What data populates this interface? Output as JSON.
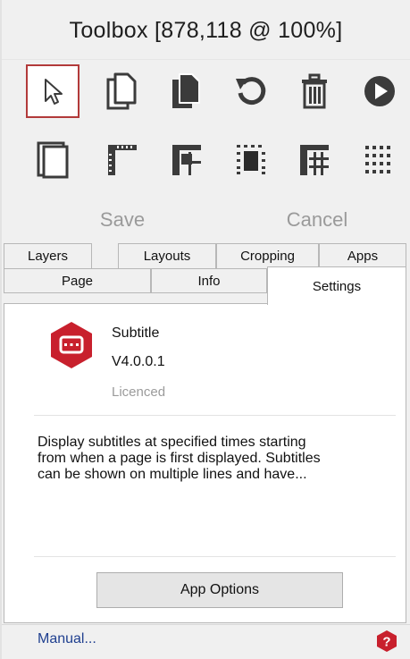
{
  "window": {
    "title": "Toolbox [878,118 @ 100%]"
  },
  "toolbar": {
    "row1": [
      {
        "icon": "pointer-icon",
        "selected": true
      },
      {
        "icon": "new-page-icon"
      },
      {
        "icon": "copy-page-icon"
      },
      {
        "icon": "undo-icon"
      },
      {
        "icon": "delete-icon"
      },
      {
        "icon": "play-icon"
      }
    ],
    "row2": [
      {
        "icon": "page-frame-icon"
      },
      {
        "icon": "layout-corner-icon"
      },
      {
        "icon": "layout-split-icon"
      },
      {
        "icon": "layout-center-icon"
      },
      {
        "icon": "layout-grid-icon"
      },
      {
        "icon": "layout-dots-icon"
      }
    ]
  },
  "actions": {
    "save_label": "Save",
    "cancel_label": "Cancel"
  },
  "tabs": {
    "back_row": [
      "Layers",
      "Layouts",
      "Cropping",
      "Apps"
    ],
    "front_row": [
      "Page",
      "Info",
      "Settings"
    ],
    "active": "Settings"
  },
  "app": {
    "icon": "subtitle-app-icon",
    "name": "Subtitle",
    "version": "V4.0.0.1",
    "licence": "Licenced",
    "description_lines": [
      "Display subtitles at specified times starting",
      "from when a page is first displayed. Subtitles",
      "can be shown on multiple lines and have..."
    ],
    "options_button": "App Options"
  },
  "footer": {
    "manual_link": "Manual...",
    "help_icon": "help-icon"
  },
  "colors": {
    "accent": "#c8202d",
    "link": "#1f3f8f",
    "disabled_text": "#9a9a9a"
  }
}
